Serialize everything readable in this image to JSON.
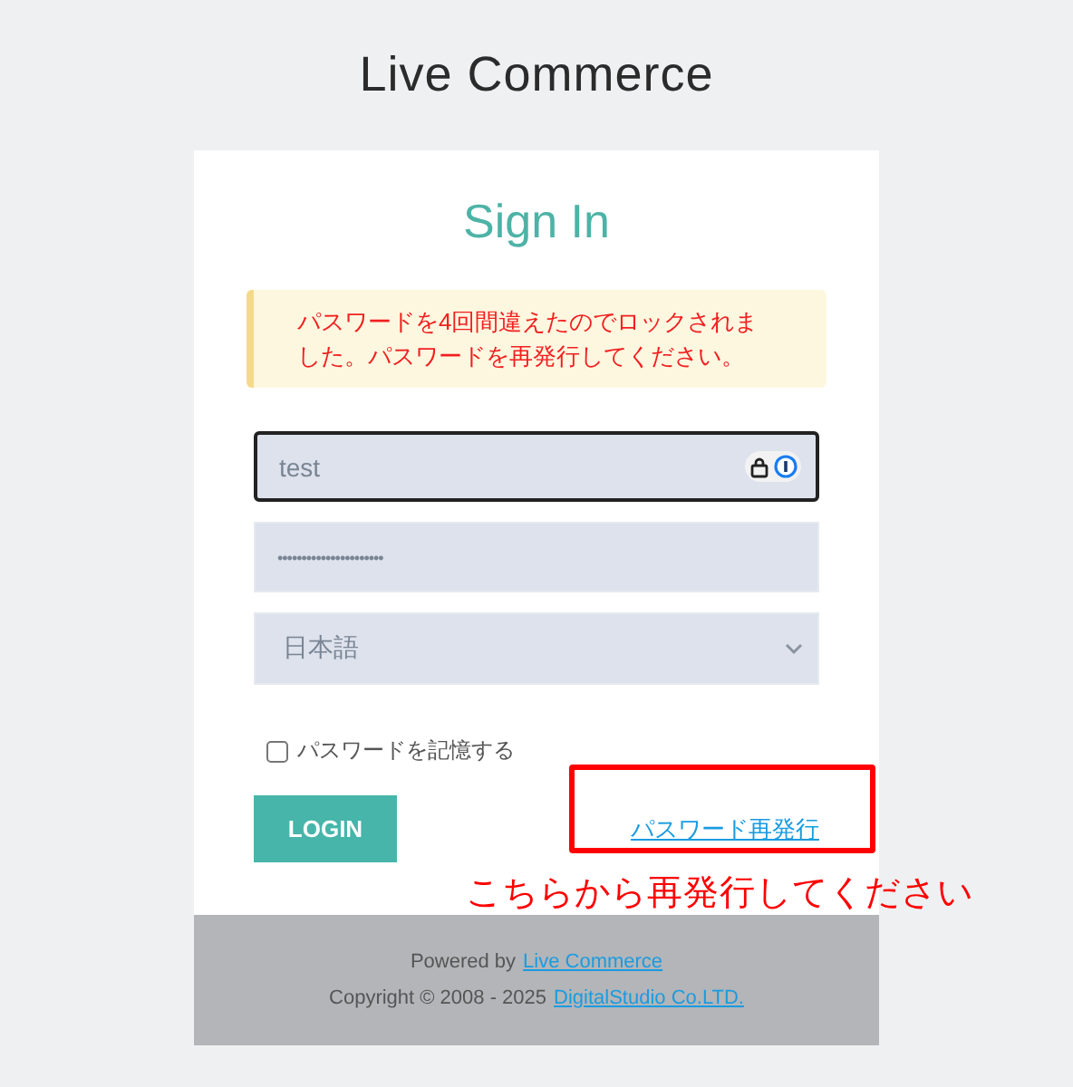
{
  "logo": "Live Commerce",
  "title": "Sign In",
  "alert": "パスワードを4回間違えたのでロックされました。パスワードを再発行してください。",
  "username": {
    "value": "test",
    "focused": true
  },
  "password": {
    "value": "••••••••••••••••••••••"
  },
  "language": {
    "value": "日本語"
  },
  "remember": {
    "label": "パスワードを記憶する",
    "checked": false
  },
  "login_button": "LOGIN",
  "reset_link": "パスワード再発行",
  "annotation": "こちらから再発行してください",
  "footer": {
    "powered_prefix": "Powered by",
    "powered_link": "Live Commerce",
    "copyright_prefix": "Copyright © 2008 - 2025",
    "copyright_link": "DigitalStudio Co.LTD."
  }
}
